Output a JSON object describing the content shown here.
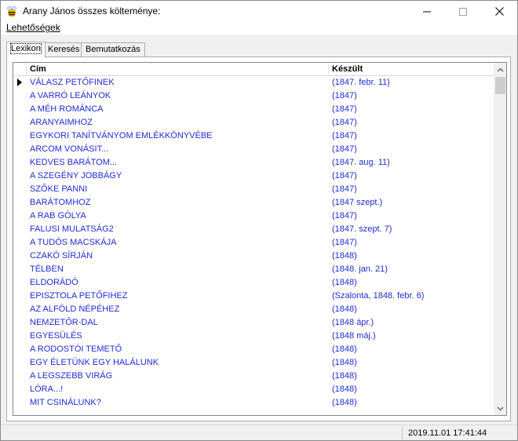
{
  "window": {
    "title": "Arany János összes költeménye:"
  },
  "menu": {
    "options_label": "Lehetőségek"
  },
  "tabs": [
    {
      "label": "Lexikon"
    },
    {
      "label": "Keresés"
    },
    {
      "label": "Bemutatkozás"
    }
  ],
  "table": {
    "headers": {
      "title": "Cím",
      "created": "Készült"
    },
    "rows": [
      {
        "title": "VÁLASZ PETŐFINEK",
        "created": "(1847. febr. 11)"
      },
      {
        "title": "A VARRÓ LEÁNYOK",
        "created": "(1847)"
      },
      {
        "title": "A MÉH ROMÁNCA",
        "created": "(1847)"
      },
      {
        "title": "ARANYAIMHOZ",
        "created": "(1847)"
      },
      {
        "title": "EGYKORI TANÍTVÁNYOM EMLÉKKÖNYVÉBE",
        "created": "(1847)"
      },
      {
        "title": "ARCOM VONÁSIT...",
        "created": "(1847)"
      },
      {
        "title": "KEDVES BARÁTOM...",
        "created": "(1847. aug. 11)"
      },
      {
        "title": "A SZEGÉNY JOBBÁGY",
        "created": "(1847)"
      },
      {
        "title": "SZŐKE PANNI",
        "created": "(1847)"
      },
      {
        "title": "BARÁTOMHOZ",
        "created": "(1847 szept.)"
      },
      {
        "title": "A RAB GÓLYA",
        "created": "(1847)"
      },
      {
        "title": "FALUSI MULATSÁG2",
        "created": "(1847. szept. 7)"
      },
      {
        "title": "A TUDÓS MACSKÁJA",
        "created": "(1847)"
      },
      {
        "title": "CZAKÓ SÍRJÁN",
        "created": "(1848)"
      },
      {
        "title": "TÉLBEN",
        "created": "(1848. jan. 21)"
      },
      {
        "title": "ELDORÁDÓ",
        "created": "(1848)"
      },
      {
        "title": "EPISZTOLA PETŐFIHEZ",
        "created": "(Szalonta, 1848. febr. 6)"
      },
      {
        "title": "AZ ALFÖLD NÉPÉHEZ",
        "created": "(1848)"
      },
      {
        "title": "NEMZETŐR-DAL",
        "created": "(1848 ápr.)"
      },
      {
        "title": "EGYESÜLÉS",
        "created": "(1848 máj.)"
      },
      {
        "title": "A RODOSTÓI TEMETŐ",
        "created": "(1848)"
      },
      {
        "title": "EGY ÉLETÜNK EGY HALÁLUNK",
        "created": "(1848)"
      },
      {
        "title": "A LEGSZEBB VIRÁG",
        "created": "(1848)"
      },
      {
        "title": "LÓRA...!",
        "created": "(1848)"
      },
      {
        "title": "MIT CSINÁLUNK?",
        "created": "(1848)"
      }
    ]
  },
  "status": {
    "datetime": "2019.11.01 17:41:44"
  },
  "colors": {
    "link_text": "#1f2dd4",
    "window_bg": "#f0f0f0"
  },
  "icons": [
    "app-bee-icon",
    "minimize-icon",
    "maximize-icon",
    "close-icon",
    "row-selector-arrow-icon",
    "scroll-up-icon",
    "scroll-down-icon"
  ]
}
